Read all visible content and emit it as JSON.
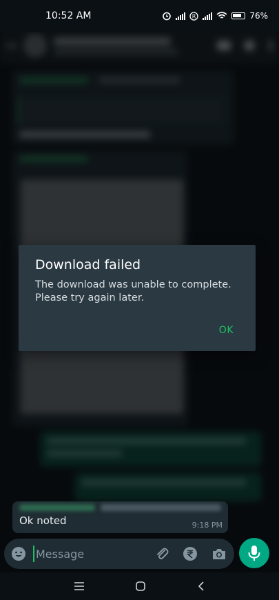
{
  "status_bar": {
    "time": "10:52 AM",
    "battery": "76"
  },
  "dialog": {
    "title": "Download failed",
    "body": "The download was unable to complete. Please try again later.",
    "ok_label": "OK"
  },
  "chat": {
    "last_message": {
      "text": "Ok noted",
      "time": "9:18 PM"
    }
  },
  "composer": {
    "placeholder": "Message",
    "icons": [
      "emoji-icon",
      "attach-icon",
      "rupee-icon",
      "camera-icon",
      "mic-icon"
    ]
  },
  "nav_bar": {
    "icons": [
      "menu-icon",
      "home-icon",
      "back-icon"
    ]
  },
  "colors": {
    "accent": "#21c063",
    "dialog_bg": "#2a3942",
    "mic_bg": "#00a884"
  }
}
